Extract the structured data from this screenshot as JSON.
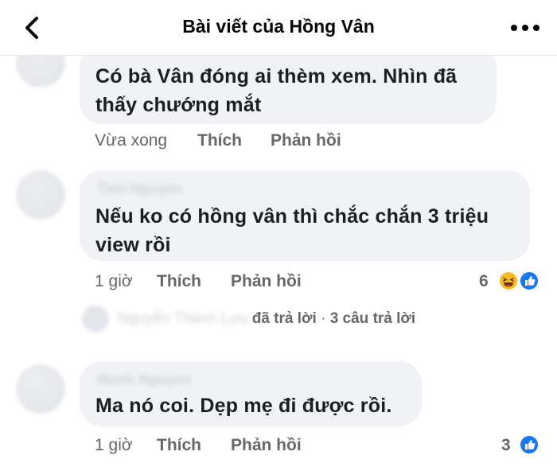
{
  "header": {
    "title": "Bài viết của Hồng Vân"
  },
  "comments": [
    {
      "author": "",
      "text_line1": "Có bà Vân đóng ai thèm xem. Nhìn đã",
      "text_line2": "thấy chướng mắt",
      "time": "Vừa xong",
      "like_label": "Thích",
      "reply_label": "Phản hồi"
    },
    {
      "author": "Tien Nguyen",
      "text_line1": "Nếu ko có hồng vân thì chắc chắn 3 triệu",
      "text_line2": "view rồi",
      "time": "1 giờ",
      "like_label": "Thích",
      "reply_label": "Phản hồi",
      "reaction_count": "6",
      "reactions": [
        "haha-icon",
        "like-icon"
      ],
      "replies": {
        "author_blurred": "Nguyễn Thành Lưu",
        "replied": "đã trả lời",
        "separator": "·",
        "count": "3 câu trả lời"
      }
    },
    {
      "author": "Manh Nguyen",
      "text_line1": "Ma nó coi. Dẹp mẹ đi được rồi.",
      "time": "1 giờ",
      "like_label": "Thích",
      "reply_label": "Phản hồi",
      "reaction_count": "3",
      "reactions": [
        "like-icon"
      ]
    }
  ],
  "colors": {
    "bubble": "#f0f2f5",
    "meta": "#65676b",
    "like_blue": "#1877f2",
    "haha_yellow": "#f7b928"
  }
}
